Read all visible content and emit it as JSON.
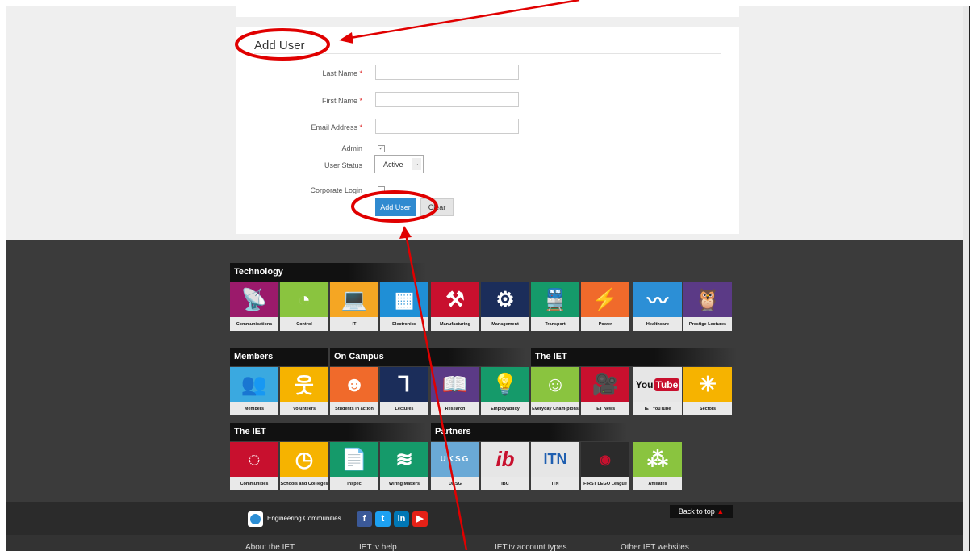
{
  "form": {
    "title": "Add User",
    "last_name_label": "Last Name",
    "first_name_label": "First Name",
    "email_label": "Email Address",
    "required_mark": "*",
    "admin_label": "Admin",
    "admin_checked": "✓",
    "status_label": "User Status",
    "status_value": "Active",
    "corporate_label": "Corporate Login",
    "add_button": "Add User",
    "clear_button": "Clear"
  },
  "sections": {
    "technology": "Technology",
    "members": "Members",
    "on_campus": "On Campus",
    "the_iet_1": "The IET",
    "the_iet_2": "The IET",
    "partners": "Partners"
  },
  "tiles": {
    "communications": "Communications",
    "control": "Control",
    "it": "IT",
    "electronics": "Electronics",
    "manufacturing": "Manufacturing",
    "management": "Management",
    "transport": "Transport",
    "power": "Power",
    "healthcare": "Healthcare",
    "prestige": "Prestige Lectures",
    "members": "Members",
    "volunteers": "Volunteers",
    "students": "Students in action",
    "lectures": "Lectures",
    "research": "Research",
    "employability": "Employability",
    "everyday": "Everyday Cham-pions",
    "ietnews": "IET News",
    "youtube": "IET YouTube",
    "sectors": "Sectors",
    "communities": "Communities",
    "schools": "Schools and Col-leges",
    "inspec": "Inspec",
    "wiring": "Wiring Matters",
    "uksg": "UKSG",
    "ibc": "IBC",
    "itn": "ITN",
    "lego": "FIRST LEGO League",
    "affiliates": "Affiliates"
  },
  "tile_icons": {
    "itn": "ITN",
    "youtube_you": "You",
    "youtube_tube": "Tube",
    "uksg": "UKSG"
  },
  "footer": {
    "back_to_top": "Back to top",
    "engineering_communities": "Engineering Communities",
    "facebook": "f",
    "twitter": "t",
    "linkedin": "in",
    "youtube": "▶",
    "nav": [
      "About the IET",
      "IET.tv help",
      "IET.tv account types",
      "Other IET websites"
    ]
  },
  "colors": {
    "annotation": "#e00000",
    "primary_button": "#2f8ad0"
  }
}
